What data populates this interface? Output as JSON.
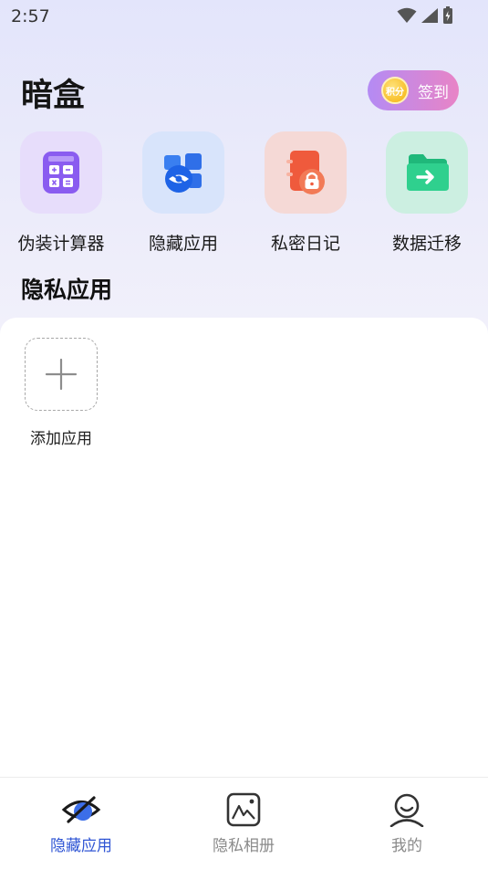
{
  "status_bar": {
    "time": "2:57"
  },
  "header": {
    "title": "暗盒",
    "checkin": {
      "coin_text": "积分",
      "label": "签到"
    }
  },
  "tools": [
    {
      "label": "伪装计算器",
      "icon": "calculator-icon"
    },
    {
      "label": "隐藏应用",
      "icon": "hidden-eye-icon"
    },
    {
      "label": "私密日记",
      "icon": "locked-diary-icon"
    },
    {
      "label": "数据迁移",
      "icon": "folder-export-icon"
    }
  ],
  "section": {
    "title": "隐私应用"
  },
  "add_app": {
    "label": "添加应用"
  },
  "bottom_nav": [
    {
      "label": "隐藏应用",
      "active": true
    },
    {
      "label": "隐私相册",
      "active": false
    },
    {
      "label": "我的",
      "active": false
    }
  ],
  "colors": {
    "accent": "#2f55d4",
    "inactive": "#8a8a8a",
    "checkin_from": "#b48bf4",
    "checkin_to": "#e884c6"
  }
}
